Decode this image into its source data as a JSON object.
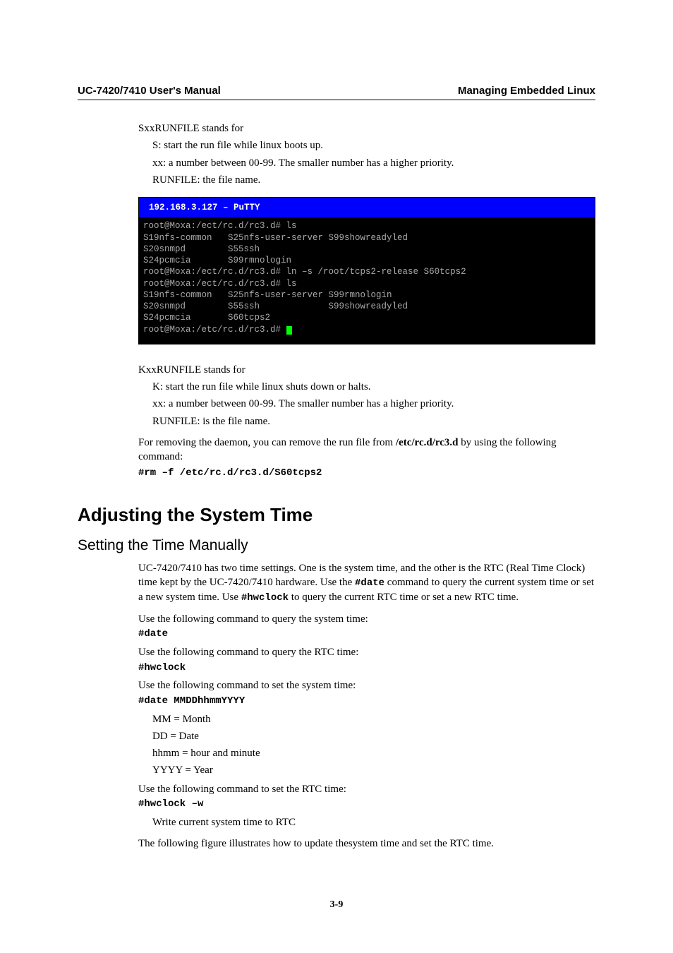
{
  "header": {
    "left": "UC-7420/7410 User's Manual",
    "right": "Managing Embedded Linux"
  },
  "sxx": {
    "lead": "SxxRUNFILE stands for",
    "l1": "S: start the run file while linux boots up.",
    "l2": "xx: a number between 00-99. The smaller number has a higher priority.",
    "l3": "RUNFILE: the file name."
  },
  "terminal": {
    "title": "  192.168.3.127 – PuTTY",
    "body": "root@Moxa:/ect/rc.d/rc3.d# ls\nS19nfs-common   S25nfs-user-server S99showreadyled\nS20snmpd        S55ssh\nS24pcmcia       S99rmnologin\nroot@Moxa:/ect/rc.d/rc3.d# ln –s /root/tcps2-release S60tcps2\nroot@Moxa:/ect/rc.d/rc3.d# ls\nS19nfs-common   S25nfs-user-server S99rmnologin\nS20snmpd        S55ssh             S99showreadyled\nS24pcmcia       S60tcps2\nroot@Moxa:/etc/rc.d/rc3.d# "
  },
  "kxx": {
    "lead": "KxxRUNFILE stands for",
    "l1": "K: start the run file while linux shuts down or halts.",
    "l2": "xx: a number between 00-99. The smaller number has a higher priority.",
    "l3": "RUNFILE: is the file name."
  },
  "remove": {
    "text_before": "For removing the daemon, you can remove the run file from ",
    "bold_path": "/etc/rc.d/rc3.d",
    "text_after": " by using the following command:",
    "cmd": "#rm –f /etc/rc.d/rc3.d/S60tcps2"
  },
  "h1": "Adjusting the System Time",
  "h2": "Setting the Time Manually",
  "time": {
    "p1a": "UC-7420/7410 has two time settings. One is the system time, and the other is the RTC (Real Time Clock) time kept by the UC-7420/7410 hardware. Use the ",
    "p1_cmd1": "#date",
    "p1b": " command to query the current system time or set a new system time. Use ",
    "p1_cmd2": "#hwclock",
    "p1c": " to query the current RTC time or set a new RTC time.",
    "q_sys": "Use the following command to query the system time:",
    "q_sys_cmd": "#date",
    "q_rtc": "Use the following command to query the RTC time:",
    "q_rtc_cmd": "#hwclock",
    "s_sys": "Use the following command to set the system time:",
    "s_sys_cmd": "#date MMDDhhmmYYYY",
    "legend": {
      "mm": "MM = Month",
      "dd": "DD = Date",
      "hhmm": "hhmm = hour and minute",
      "yyyy": "YYYY = Year"
    },
    "s_rtc": "Use the following command to set the RTC time:",
    "s_rtc_cmd": "#hwclock –w",
    "s_rtc_note": "Write current system time to RTC",
    "closing": "The following figure illustrates how to update thesystem time and set the RTC time."
  },
  "footer": "3-9"
}
